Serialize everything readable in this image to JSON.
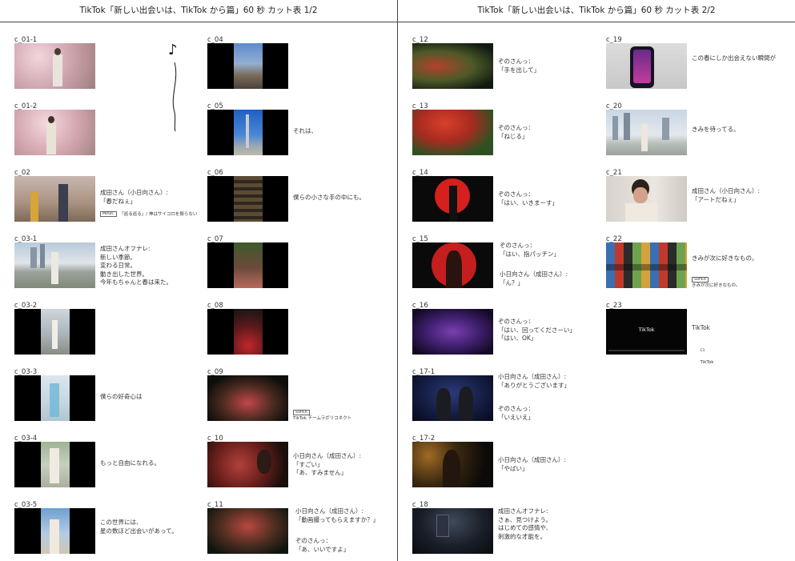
{
  "pages": [
    {
      "title": "TikTok「新しい出会いは、TikTok から篇」60 秒 カット表 1/2",
      "music_icon": "music-note-icon",
      "cuts": [
        {
          "label": "c_01-1",
          "text": ""
        },
        {
          "label": "c_01-2",
          "text": ""
        },
        {
          "label": "c_02",
          "text": "成田さん（小日向さん）:\n「春だねぇ」",
          "music_note": "「巡る巡る」/ 神はサイコロを振らない"
        },
        {
          "label": "c_03-1",
          "text": "成田さんオフナレ:\n新しい季節。\n変わる日常。\n動き出した世界。\n今年もちゃんと春は来た。"
        },
        {
          "label": "c_03-2",
          "text": ""
        },
        {
          "label": "c_03-3",
          "text": "僕らの好奇心は"
        },
        {
          "label": "c_03-4",
          "text": "もっと自由になれる。"
        },
        {
          "label": "c_03-5",
          "text": "この世界には、\n星の数ほど出会いがあって。"
        },
        {
          "label": "c_04",
          "text": ""
        },
        {
          "label": "c_05",
          "text": "それは、"
        },
        {
          "label": "c_06",
          "text": "僕らの小さな手の中にも。"
        },
        {
          "label": "c_07",
          "text": ""
        },
        {
          "label": "c_08",
          "text": ""
        },
        {
          "label": "c_09",
          "text": "",
          "super": "TikTok チームラボリコネクト"
        },
        {
          "label": "c_10",
          "text": "小日向さん（成田さん）:\n「すごい」\n「あ、すみません」"
        },
        {
          "label": "c_11",
          "text": "小日向さん（成田さん）:\n「動画撮ってもらえますか？」",
          "text2": "ぞのさんっ：\n「あ、いいですよ」"
        }
      ]
    },
    {
      "title": "TikTok「新しい出会いは、TikTok から篇」60 秒 カット表 2/2",
      "cuts": [
        {
          "label": "c_12",
          "text": "ぞのさんっ：\n「手を出して」"
        },
        {
          "label": "c_13",
          "text": "ぞのさんっ：\n「ねじる」"
        },
        {
          "label": "c_14",
          "text": "ぞのさんっ：\n「はい、いきまーす」"
        },
        {
          "label": "c_15",
          "text": "ぞのさんっ：\n「はい、指パッチン」",
          "text2": "小日向さん（成田さん）:\n「ん？」"
        },
        {
          "label": "c_16",
          "text": "ぞのさんっ：\n「はい、回ってくださーい」\n「はい、OK」"
        },
        {
          "label": "c_17-1",
          "text": "小日向さん（成田さん）:\n「ありがとうございます」",
          "text2": "ぞのさんっ：\n「いえいえ」"
        },
        {
          "label": "c_17-2",
          "text": "小日向さん（成田さん）:\n「やばい」"
        },
        {
          "label": "c_18",
          "text": "成田さんオフナレ:\nさぁ、見つけよう。\nはじめての感情や、\n刺激的な才能を。"
        },
        {
          "label": "c_19",
          "text": "この春にしか出会えない瞬間が"
        },
        {
          "label": "c_20",
          "text": "きみを待ってる。"
        },
        {
          "label": "c_21",
          "text": "成田さん（小日向さん）:\n「アートだねぇ」"
        },
        {
          "label": "c_22",
          "text": "きみが次に好きなもの。",
          "super": "きみが次に好きなもの。"
        },
        {
          "label": "c_23",
          "text": "TikTok",
          "endcard": "TikTok",
          "thumb_logo": "TikTok"
        }
      ]
    }
  ],
  "super_badge": "SUPER",
  "music_badge": "MUSIC",
  "colors": {
    "border": "#444444",
    "text": "#222222"
  }
}
